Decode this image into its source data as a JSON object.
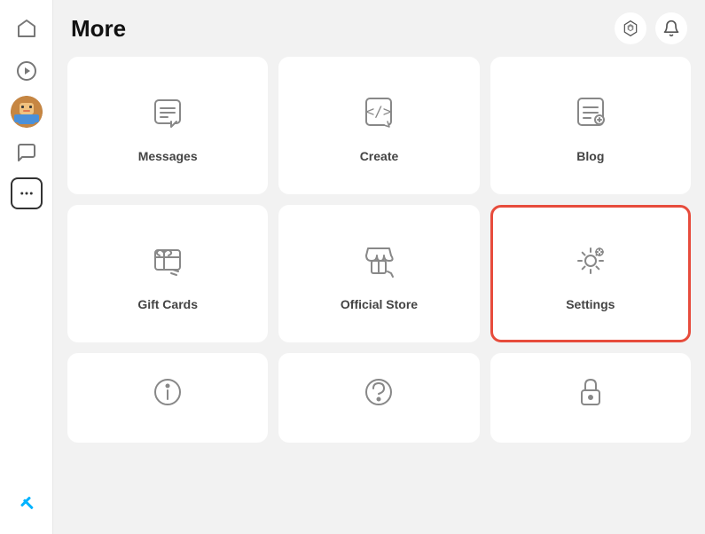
{
  "header": {
    "title": "More",
    "robux_icon": "robux-icon",
    "notification_icon": "notification-icon"
  },
  "sidebar": {
    "items": [
      {
        "id": "home",
        "icon": "home-icon",
        "label": "Home"
      },
      {
        "id": "discover",
        "icon": "discover-icon",
        "label": "Discover"
      },
      {
        "id": "avatar",
        "icon": "avatar-icon",
        "label": "Avatar"
      },
      {
        "id": "chat",
        "icon": "chat-icon",
        "label": "Chat"
      },
      {
        "id": "more",
        "icon": "more-icon",
        "label": "More"
      }
    ],
    "bottom_item": {
      "id": "robux-sidebar",
      "icon": "robux-sidebar-icon",
      "label": "Robux"
    }
  },
  "grid": {
    "items": [
      {
        "id": "messages",
        "label": "Messages",
        "icon": "messages-icon",
        "highlighted": false
      },
      {
        "id": "create",
        "label": "Create",
        "icon": "create-icon",
        "highlighted": false
      },
      {
        "id": "blog",
        "label": "Blog",
        "icon": "blog-icon",
        "highlighted": false
      },
      {
        "id": "gift-cards",
        "label": "Gift Cards",
        "icon": "gift-cards-icon",
        "highlighted": false
      },
      {
        "id": "official-store",
        "label": "Official Store",
        "icon": "official-store-icon",
        "highlighted": false
      },
      {
        "id": "settings",
        "label": "Settings",
        "icon": "settings-icon",
        "highlighted": true
      },
      {
        "id": "info",
        "label": "",
        "icon": "info-icon",
        "highlighted": false,
        "partial": true
      },
      {
        "id": "help",
        "label": "",
        "icon": "help-icon",
        "highlighted": false,
        "partial": true
      },
      {
        "id": "lock",
        "label": "",
        "icon": "lock-icon",
        "highlighted": false,
        "partial": true
      }
    ]
  }
}
